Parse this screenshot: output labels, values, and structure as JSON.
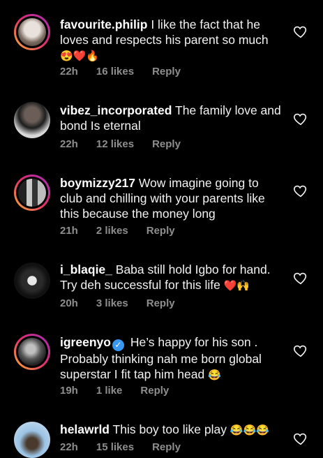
{
  "comments": [
    {
      "user": "favourite.philip",
      "text": "I like the fact that he loves and respects his parent so much",
      "emoji": "😍❤️🔥",
      "time": "22h",
      "likes": "16 likes",
      "reply": "Reply"
    },
    {
      "user": "vibez_incorporated",
      "text": "The family love and bond Is eternal",
      "emoji": "",
      "time": "22h",
      "likes": "12 likes",
      "reply": "Reply"
    },
    {
      "user": "boymizzy217",
      "text": "Wow imagine going to club and chilling with your parents like this because the money long",
      "emoji": "",
      "time": "21h",
      "likes": "2 likes",
      "reply": "Reply"
    },
    {
      "user": "i_blaqie_",
      "text": "Baba still hold Igbo for hand. Try deh successful for this life",
      "emoji": "❤️🙌",
      "time": "20h",
      "likes": "3 likes",
      "reply": "Reply"
    },
    {
      "user": "igreenyo",
      "text": "He’s happy for his son . Probably thinking nah me born global superstar I fit tap him head",
      "emoji": "😂",
      "time": "19h",
      "likes": "1 like",
      "reply": "Reply"
    },
    {
      "user": "helawrld",
      "text": "This boy too like play",
      "emoji": "😂😂😂",
      "time": "22h",
      "likes": "15 likes",
      "reply": "Reply"
    }
  ],
  "icons": {
    "like": "heart-outline-icon",
    "verified": "verified-badge-icon"
  },
  "colors": {
    "background": "#000000",
    "text": "#f2f2f2",
    "meta": "#8e8e8e",
    "verified": "#3897f0"
  }
}
